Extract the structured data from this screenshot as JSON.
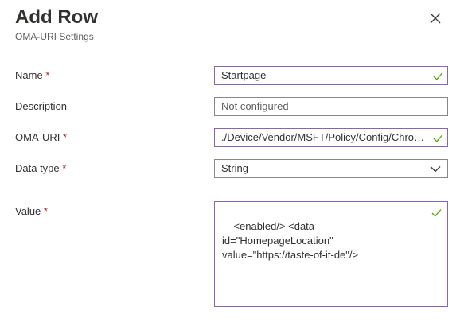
{
  "header": {
    "title": "Add Row",
    "subtitle": "OMA-URI Settings"
  },
  "form": {
    "required_marker": "*",
    "name": {
      "label": "Name",
      "value": "Startpage"
    },
    "description": {
      "label": "Description",
      "placeholder": "Not configured"
    },
    "oma_uri": {
      "label": "OMA-URI",
      "value": "./Device/Vendor/MSFT/Policy/Config/Chrom..."
    },
    "data_type": {
      "label": "Data type",
      "selected": "String"
    },
    "value": {
      "label": "Value",
      "text": "<enabled/> <data id=\"HomepageLocation\" value=\"https://taste-of-it-de\"/>"
    }
  },
  "icons": {
    "close": "close-icon",
    "check": "checkmark-icon",
    "dropdown": "chevron-down-icon"
  },
  "colors": {
    "required": "#a4262c",
    "valid_border": "#8764b8",
    "check": "#57a300"
  }
}
